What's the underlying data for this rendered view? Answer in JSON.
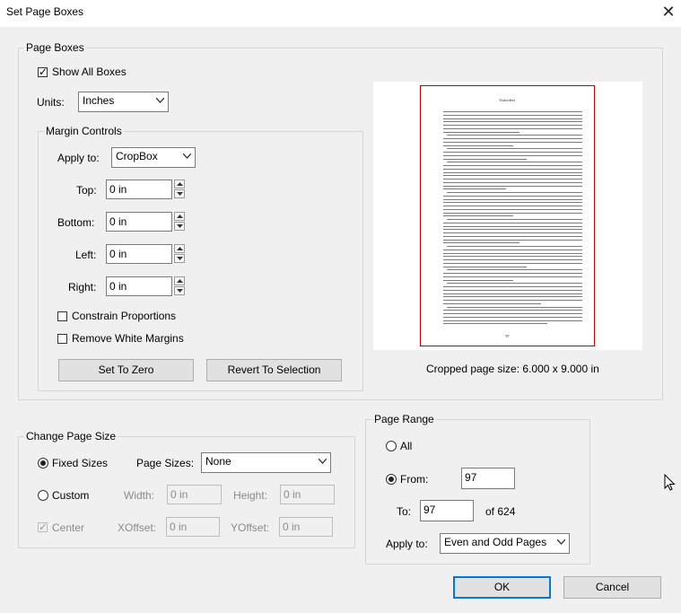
{
  "window": {
    "title": "Set Page Boxes",
    "close_icon": "close-icon"
  },
  "page_boxes": {
    "label": "Page Boxes",
    "show_all_boxes": {
      "label": "Show All Boxes",
      "checked": true
    },
    "units": {
      "label": "Units:",
      "value": "Inches"
    },
    "margin_controls": {
      "label": "Margin Controls",
      "apply_to": {
        "label": "Apply to:",
        "value": "CropBox"
      },
      "top": {
        "label": "Top:",
        "value": "0 in"
      },
      "bottom": {
        "label": "Bottom:",
        "value": "0 in"
      },
      "left": {
        "label": "Left:",
        "value": "0 in"
      },
      "right": {
        "label": "Right:",
        "value": "0 in"
      },
      "constrain_proportions": {
        "label": "Constrain Proportions",
        "checked": false
      },
      "remove_white_margins": {
        "label": "Remove White Margins",
        "checked": false
      },
      "set_to_zero": "Set To Zero",
      "revert_to_selection": "Revert To Selection"
    },
    "preview": {
      "heading": "Outsiders",
      "page_number": "97"
    },
    "cropped_size": "Cropped page size: 6.000 x 9.000 in"
  },
  "change_page_size": {
    "label": "Change Page Size",
    "fixed_sizes": {
      "label": "Fixed Sizes",
      "selected": true
    },
    "page_sizes": {
      "label": "Page Sizes:",
      "value": "None"
    },
    "custom": {
      "label": "Custom",
      "selected": false
    },
    "width": {
      "label": "Width:",
      "value": "0 in"
    },
    "height": {
      "label": "Height:",
      "value": "0 in"
    },
    "center": {
      "label": "Center",
      "checked": true
    },
    "xoffset": {
      "label": "XOffset:",
      "value": "0 in"
    },
    "yoffset": {
      "label": "YOffset:",
      "value": "0 in"
    }
  },
  "page_range": {
    "label": "Page Range",
    "all": {
      "label": "All",
      "selected": false
    },
    "from": {
      "label": "From:",
      "value": "97",
      "selected": true
    },
    "to": {
      "label": "To:",
      "value": "97"
    },
    "of_total": "of 624",
    "apply_to": {
      "label": "Apply to:",
      "value": "Even and Odd Pages"
    }
  },
  "buttons": {
    "ok": "OK",
    "cancel": "Cancel"
  }
}
